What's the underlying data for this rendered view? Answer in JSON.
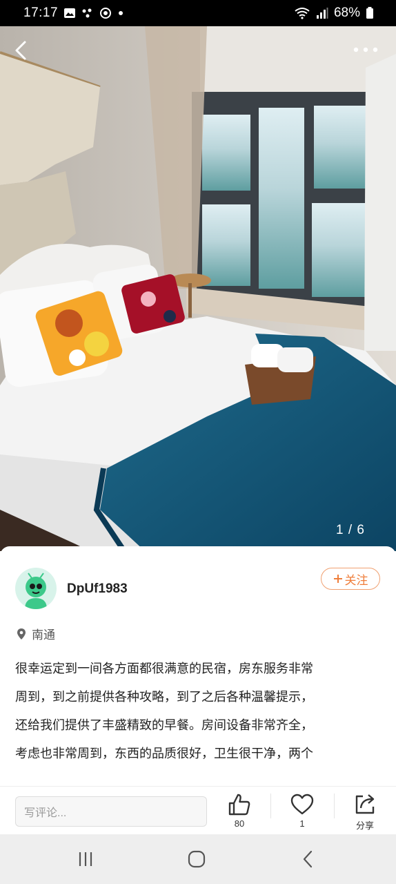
{
  "status_bar": {
    "time": "17:17",
    "battery": "68%",
    "icons": [
      "image-icon",
      "dots-icon",
      "target-icon",
      "dot-icon"
    ],
    "right_icons": [
      "wifi-icon",
      "signal-icon",
      "battery-icon"
    ]
  },
  "photo": {
    "counter": "1 / 6",
    "back_icon": "chevron-left-icon",
    "more_icon": "more-icon"
  },
  "post": {
    "username": "DpUf1983",
    "follow_label": "关注",
    "location": "南通",
    "review_lines": [
      "很幸运定到一间各方面都很满意的民宿，房东服务非常",
      "周到，到之前提供各种攻略，到了之后各种温馨提示，",
      "还给我们提供了丰盛精致的早餐。房间设备非常齐全，",
      "考虑也非常周到，东西的品质很好，卫生很干净，两个"
    ]
  },
  "bottom_bar": {
    "comment_placeholder": "写评论...",
    "like_count": "80",
    "favorite_count": "1",
    "share_label": "分享"
  },
  "colors": {
    "accent": "#ef7d3a",
    "avatar_bg": "#d8f3ea",
    "avatar_face": "#3cc98a"
  }
}
